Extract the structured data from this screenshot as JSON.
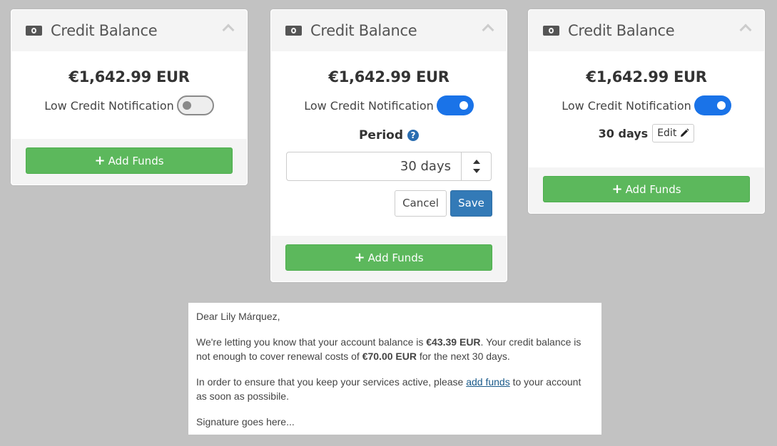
{
  "cards": [
    {
      "title": "Credit Balance",
      "balance": "€1,642.99 EUR",
      "notification_label": "Low Credit Notification",
      "notification_on": false,
      "add_funds_label": "Add Funds"
    },
    {
      "title": "Credit Balance",
      "balance": "€1,642.99 EUR",
      "notification_label": "Low Credit Notification",
      "notification_on": true,
      "period_label": "Period",
      "period_value": "30 days",
      "cancel_label": "Cancel",
      "save_label": "Save",
      "add_funds_label": "Add Funds"
    },
    {
      "title": "Credit Balance",
      "balance": "€1,642.99 EUR",
      "notification_label": "Low Credit Notification",
      "notification_on": true,
      "period_value": "30 days",
      "edit_label": "Edit",
      "add_funds_label": "Add Funds"
    }
  ],
  "email": {
    "greeting": "Dear Lily Márquez,",
    "p1_a": "We're letting you know that your account balance is ",
    "p1_balance": "€43.39 EUR",
    "p1_b": ". Your credit balance is not enough to cover renewal costs of ",
    "p1_cost": "€70.00 EUR",
    "p1_c": " for the next 30 days.",
    "p2_a": "In order to ensure that you keep your services active, please ",
    "p2_link": "add funds",
    "p2_b": " to your account as soon as possibile.",
    "signature": "Signature goes here..."
  },
  "colors": {
    "background": "#c2c2c2",
    "toggle_on": "#1a73e8",
    "add_funds_green": "#5cb85c",
    "save_blue": "#337ab7"
  },
  "icons": [
    "money-icon",
    "chevron-up-icon",
    "plus-icon",
    "help-icon",
    "pencil-icon",
    "arrow-up-icon",
    "arrow-down-icon"
  ]
}
